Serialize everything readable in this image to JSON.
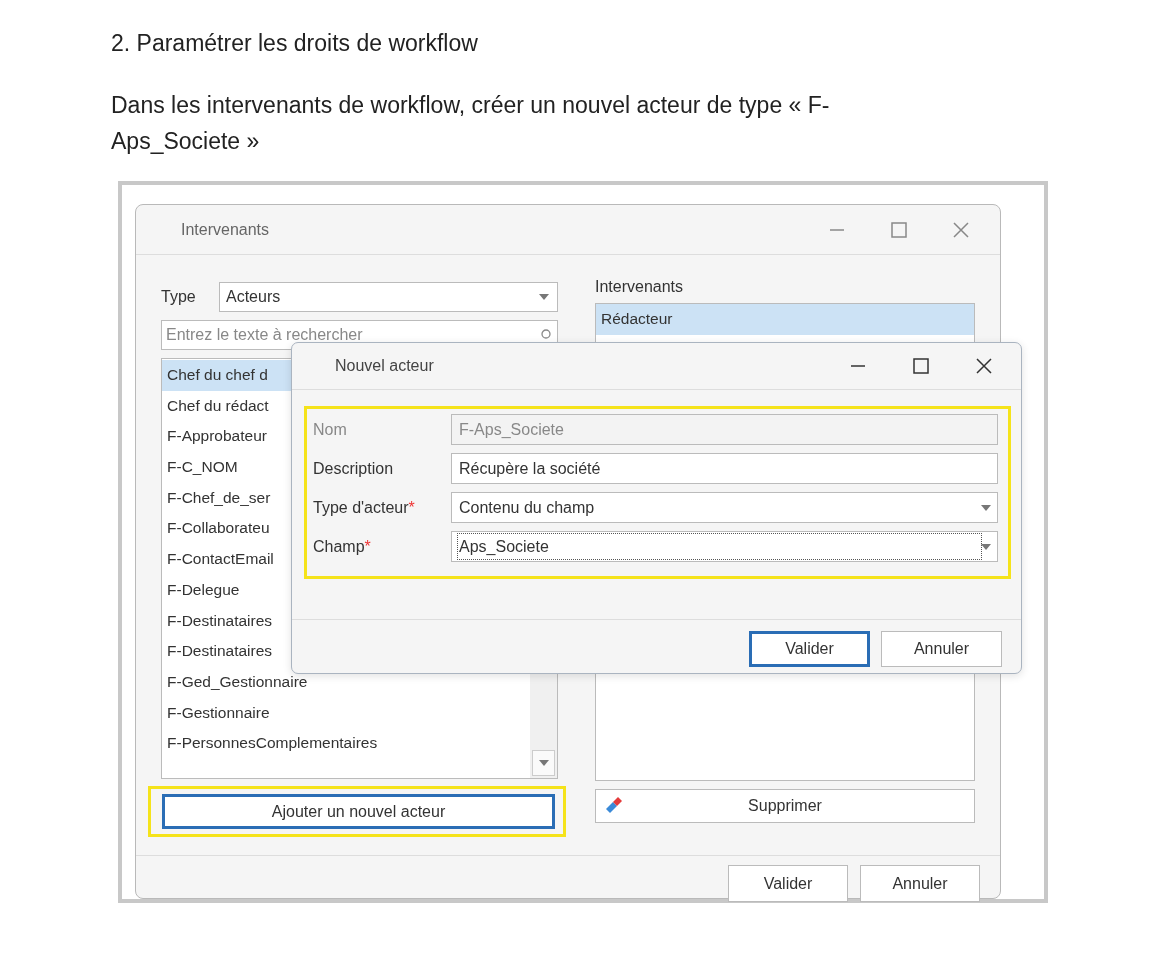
{
  "heading": "2. Paramétrer les droits de workflow",
  "paragraph": "Dans les intervenants de workflow, créer un nouvel acteur de type « F-Aps_Societe »",
  "main_window": {
    "title": "Intervenants",
    "type_label": "Type",
    "type_value": "Acteurs",
    "search": {
      "placeholder": "Entrez le texte à rechercher"
    },
    "actors": [
      {
        "label": "Chef du chef d",
        "selected": true
      },
      {
        "label": "Chef du rédact",
        "selected": false
      },
      {
        "label": "F-Approbateur",
        "selected": false
      },
      {
        "label": "F-C_NOM",
        "selected": false
      },
      {
        "label": "F-Chef_de_ser",
        "selected": false
      },
      {
        "label": "F-Collaborateu",
        "selected": false
      },
      {
        "label": "F-ContactEmail",
        "selected": false
      },
      {
        "label": "F-Delegue",
        "selected": false
      },
      {
        "label": "F-Destinataires",
        "selected": false
      },
      {
        "label": "F-Destinataires",
        "selected": false
      },
      {
        "label": "F-Ged_Gestionnaire",
        "selected": false
      },
      {
        "label": "F-Gestionnaire",
        "selected": false
      },
      {
        "label": "F-PersonnesComplementaires",
        "selected": false
      }
    ],
    "add_button": {
      "label": "Ajouter un nouvel acteur",
      "highlighted": true,
      "focused": true
    },
    "participants_label": "Intervenants",
    "participants": [
      {
        "label": "Rédacteur",
        "selected": true
      }
    ],
    "delete_button": "Supprimer",
    "buttons": [
      {
        "label": "Valider",
        "focused": false
      },
      {
        "label": "Annuler",
        "focused": false
      }
    ]
  },
  "dialog": {
    "title": "Nouvel acteur",
    "highlighted": true,
    "required_marker": "*",
    "fields": [
      {
        "kind": "text",
        "label": "Nom",
        "value": "F-Aps_Societe",
        "disabled": true,
        "required": false,
        "focused": false
      },
      {
        "kind": "text",
        "label": "Description",
        "value": "Récupère la société",
        "disabled": false,
        "required": false,
        "focused": false
      },
      {
        "kind": "dropdown",
        "label": "Type d'acteur",
        "value": "Contenu du champ",
        "disabled": false,
        "required": true,
        "focused": false
      },
      {
        "kind": "dropdown",
        "label": "Champ",
        "value": "Aps_Societe",
        "disabled": false,
        "required": true,
        "focused": true
      }
    ],
    "buttons": [
      {
        "label": "Valider",
        "focused": true
      },
      {
        "label": "Annuler",
        "focused": false
      }
    ]
  }
}
